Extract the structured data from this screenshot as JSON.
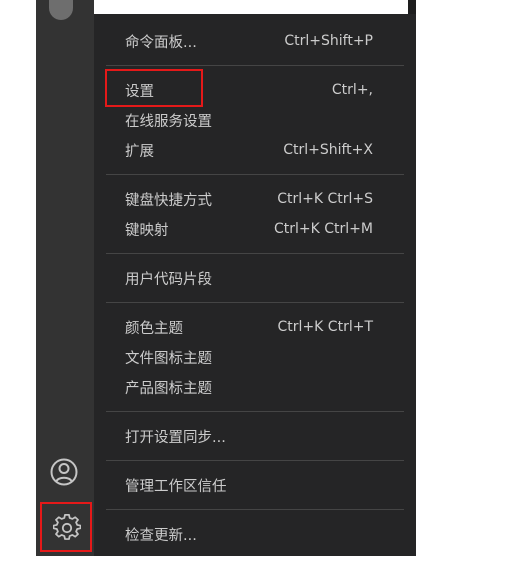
{
  "menu": {
    "groups": [
      [
        {
          "label": "命令面板...",
          "shortcut": "Ctrl+Shift+P"
        }
      ],
      [
        {
          "label": "设置",
          "shortcut": "Ctrl+,"
        },
        {
          "label": "在线服务设置",
          "shortcut": ""
        },
        {
          "label": "扩展",
          "shortcut": "Ctrl+Shift+X"
        }
      ],
      [
        {
          "label": "键盘快捷方式",
          "shortcut": "Ctrl+K Ctrl+S"
        },
        {
          "label": "键映射",
          "shortcut": "Ctrl+K Ctrl+M"
        }
      ],
      [
        {
          "label": "用户代码片段",
          "shortcut": ""
        }
      ],
      [
        {
          "label": "颜色主题",
          "shortcut": "Ctrl+K Ctrl+T"
        },
        {
          "label": "文件图标主题",
          "shortcut": ""
        },
        {
          "label": "产品图标主题",
          "shortcut": ""
        }
      ],
      [
        {
          "label": "打开设置同步...",
          "shortcut": ""
        }
      ],
      [
        {
          "label": "管理工作区信任",
          "shortcut": ""
        }
      ],
      [
        {
          "label": "检查更新...",
          "shortcut": ""
        }
      ]
    ]
  },
  "colors": {
    "activity_bar": "#333333",
    "menu_background": "#252526",
    "menu_text": "#cccccc",
    "highlight": "#e51919"
  },
  "icons": {
    "account": "account-icon",
    "manage": "gear-icon"
  }
}
